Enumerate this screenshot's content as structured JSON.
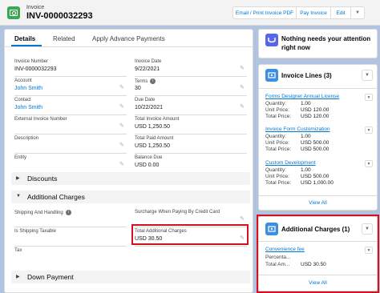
{
  "header": {
    "object_label": "Invoice",
    "title": "INV-0000032293",
    "buttons": [
      "Email / Print Invoice PDF",
      "Pay Invoice",
      "Edit"
    ]
  },
  "tabs": [
    "Details",
    "Related",
    "Apply Advance Payments"
  ],
  "details": {
    "invoice_number": {
      "label": "Invoice Number",
      "value": "INV-0000032293"
    },
    "invoice_date": {
      "label": "Invoice Date",
      "value": "9/22/2021"
    },
    "account": {
      "label": "Account",
      "value": "John Smith"
    },
    "terms": {
      "label": "Terms",
      "value": "30"
    },
    "contact": {
      "label": "Contact",
      "value": "John Smith"
    },
    "due_date": {
      "label": "Due Date",
      "value": "10/22/2021"
    },
    "external_invoice_number": {
      "label": "External Invoice Number",
      "value": ""
    },
    "total_invoice_amount": {
      "label": "Total Invoice Amount",
      "value": "USD 1,250.50"
    },
    "description": {
      "label": "Description",
      "value": ""
    },
    "total_paid_amount": {
      "label": "Total Paid Amount",
      "value": "USD 1,250.50"
    },
    "entity": {
      "label": "Entity",
      "value": ""
    },
    "balance_due": {
      "label": "Balance Due",
      "value": "USD 0.00"
    }
  },
  "sections": {
    "discounts": "Discounts",
    "additional_charges": "Additional Charges",
    "down_payment": "Down Payment"
  },
  "additional_charges_fields": {
    "shipping_and_handling": {
      "label": "Shipping And Handling",
      "value": ""
    },
    "surcharge": {
      "label": "Surcharge When Paying By Credit Card",
      "value": ""
    },
    "is_shipping_taxable": {
      "label": "Is Shipping Taxable",
      "value": ""
    },
    "total_additional_charges": {
      "label": "Total Additional Charges",
      "value": "USD 30.50"
    },
    "tax": {
      "label": "Tax",
      "value": ""
    }
  },
  "attention_card": {
    "text": "Nothing needs your attention right now"
  },
  "invoice_lines": {
    "title": "Invoice Lines (3)",
    "items": [
      {
        "name": "Forms Designer Annual License",
        "quantity": "1.00",
        "unit_price": "USD 120.00",
        "total_price": "USD 120.00"
      },
      {
        "name": "Invoice Form Customization",
        "quantity": "1.00",
        "unit_price": "USD 500.00",
        "total_price": "USD 500.00"
      },
      {
        "name": "Custom Development",
        "quantity": "1.00",
        "unit_price": "USD 500.00",
        "total_price": "USD 1,000.00"
      }
    ],
    "labels": {
      "quantity": "Quantity:",
      "unit_price": "Unit Price:",
      "total_price": "Total Price:"
    },
    "view_all": "View All"
  },
  "additional_charges_card": {
    "title": "Additional Charges (1)",
    "item_name": "Convenience fee",
    "percentage_label": "Percenta...",
    "total_label": "Total Am...",
    "total_value": "USD 30.50",
    "view_all": "View All"
  },
  "colors": {
    "accent": "#0176d3",
    "highlight": "#d4101e",
    "invoice_icon": "#3ba755",
    "card_icon": "#3e8ede"
  }
}
